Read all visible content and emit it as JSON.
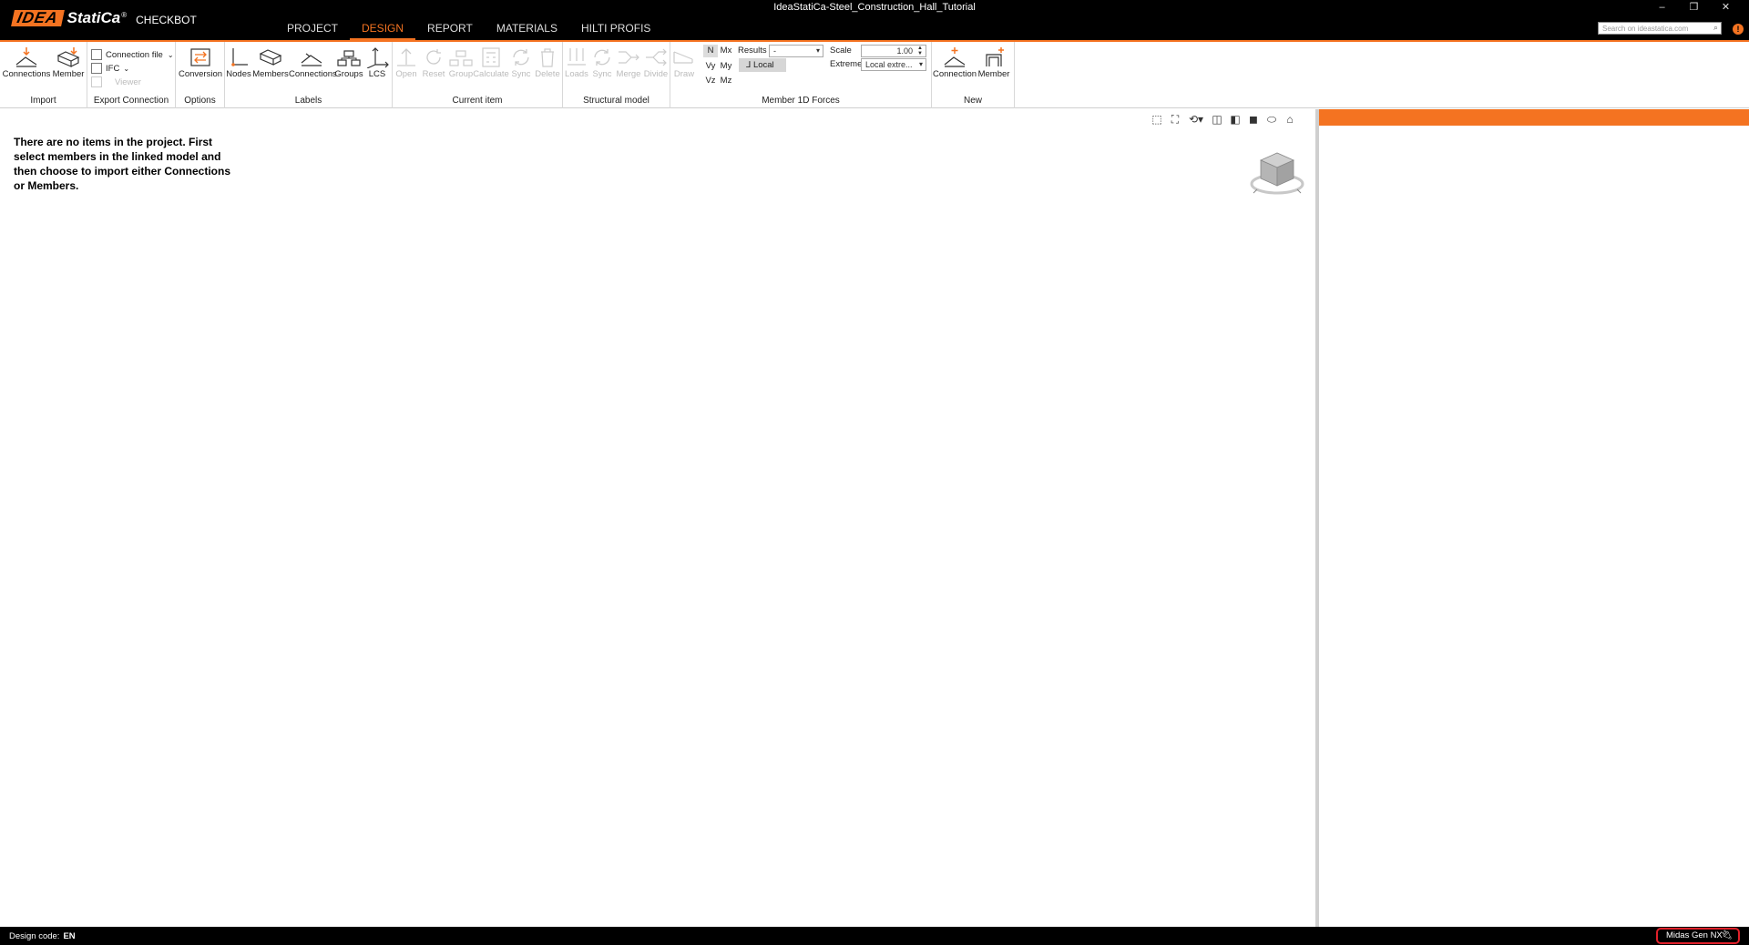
{
  "titlebar": {
    "logo_idea": "IDEA",
    "logo_statica": "StatiCa",
    "logo_reg": "®",
    "product": "CHECKBOT",
    "window_title": "IdeaStatiCa-Steel_Construction_Hall_Tutorial",
    "tabs": [
      "PROJECT",
      "DESIGN",
      "REPORT",
      "MATERIALS",
      "HILTI PROFIS"
    ],
    "active_tab": "DESIGN",
    "search_placeholder": "Search on ideastatica.com",
    "info_icon": "!",
    "minimize": "–",
    "restore": "❐",
    "close": "✕"
  },
  "ribbon": {
    "import": {
      "label": "Import",
      "connections": "Connections",
      "member": "Member"
    },
    "export": {
      "label": "Export Connection",
      "connection_file": "Connection file",
      "ifc": "IFC",
      "viewer": "Viewer"
    },
    "options": {
      "label": "Options",
      "conversion": "Conversion"
    },
    "labels": {
      "label": "Labels",
      "nodes": "Nodes",
      "members": "Members",
      "connections": "Connections",
      "groups": "Groups",
      "lcs": "LCS"
    },
    "current_item": {
      "label": "Current item",
      "open": "Open",
      "reset": "Reset",
      "group": "Group",
      "calculate": "Calculate",
      "sync": "Sync",
      "delete": "Delete"
    },
    "structural_model": {
      "label": "Structural model",
      "loads": "Loads",
      "sync": "Sync",
      "merge": "Merge",
      "divide": "Divide"
    },
    "member_forces": {
      "label": "Member 1D Forces",
      "draw": "Draw",
      "n": "N",
      "mx": "Mx",
      "vy": "Vy",
      "my": "My",
      "vz": "Vz",
      "mz": "Mz",
      "results_label": "Results",
      "results_value": "-",
      "local": "Local",
      "scale_label": "Scale",
      "scale_value": "1.00",
      "extreme_label": "Extreme",
      "extreme_value": "Local extre..."
    },
    "new": {
      "label": "New",
      "connection": "Connection",
      "member": "Member"
    }
  },
  "main": {
    "empty_message": "There are no items in the project. First select members in the linked model and then choose to import either Connections or Members."
  },
  "statusbar": {
    "design_code_label": "Design code:",
    "design_code_value": "EN",
    "linked_app": "Midas Gen NX"
  },
  "colors": {
    "accent": "#f47321",
    "titlebar": "#000000",
    "highlight_border": "#e0202a"
  }
}
